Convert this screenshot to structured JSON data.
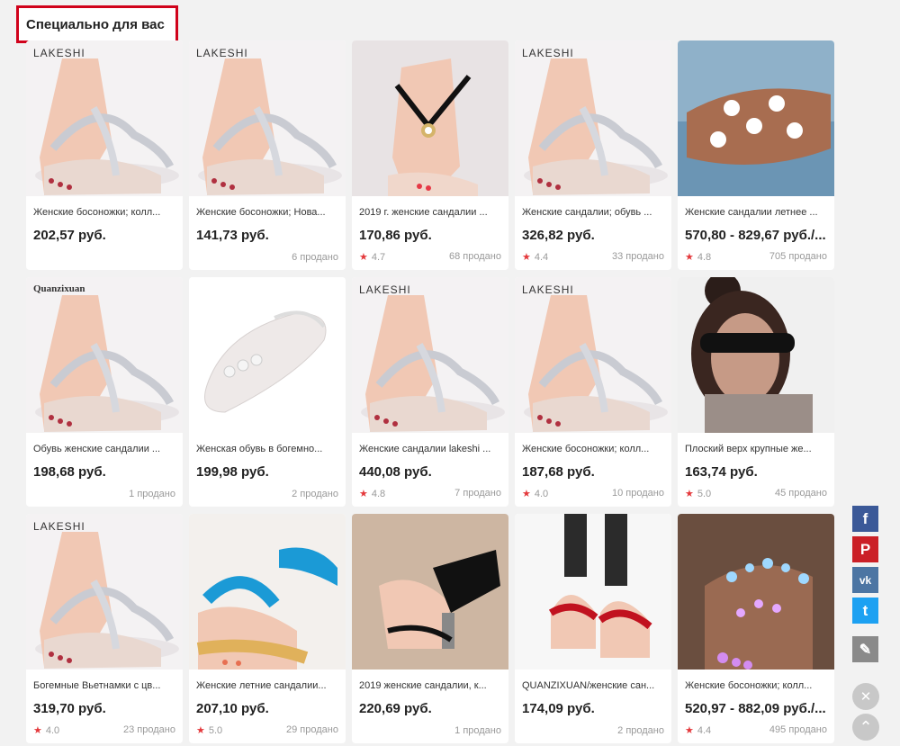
{
  "section": {
    "title": "Специально для вас"
  },
  "products": [
    {
      "brand": "LAKESHI",
      "title": "Женские босоножки; колл...",
      "price": "202,57 руб.",
      "rating": "",
      "sold": "",
      "img": "crystal"
    },
    {
      "brand": "LAKESHI",
      "title": "Женские босоножки; Нова...",
      "price": "141,73 руб.",
      "rating": "",
      "sold": "6 продано",
      "img": "crystal"
    },
    {
      "brand": "",
      "title": "2019 г. женские сандалии ...",
      "price": "170,86 руб.",
      "rating": "4.7",
      "sold": "68 продано",
      "img": "owl"
    },
    {
      "brand": "LAKESHI",
      "title": "Женские сандалии; обувь ...",
      "price": "326,82 руб.",
      "rating": "4.4",
      "sold": "33 продано",
      "img": "crystal"
    },
    {
      "brand": "",
      "title": "Женские сандалии летнее ...",
      "price": "570,80 - 829,67 руб./...",
      "rating": "4.8",
      "sold": "705 продано",
      "img": "flowers"
    },
    {
      "brand": "Quanzixuan",
      "title": "Обувь женские сандалии ...",
      "price": "198,68 руб.",
      "rating": "",
      "sold": "1 продано",
      "img": "crystal"
    },
    {
      "brand": "",
      "title": "Женская обувь в богемно...",
      "price": "199,98 руб.",
      "rating": "",
      "sold": "2 продано",
      "img": "white"
    },
    {
      "brand": "LAKESHI",
      "title": "Женские сандалии lakeshi ...",
      "price": "440,08 руб.",
      "rating": "4.8",
      "sold": "7 продано",
      "img": "crystal"
    },
    {
      "brand": "LAKESHI",
      "title": "Женские босоножки; колл...",
      "price": "187,68 руб.",
      "rating": "4.0",
      "sold": "10 продано",
      "img": "crystal"
    },
    {
      "brand": "",
      "title": "Плоский верх крупные же...",
      "price": "163,74 руб.",
      "rating": "5.0",
      "sold": "45 продано",
      "img": "sunglasses"
    },
    {
      "brand": "LAKESHI",
      "title": "Богемные Вьетнамки с цв...",
      "price": "319,70 руб.",
      "rating": "4.0",
      "sold": "23 продано",
      "img": "crystal"
    },
    {
      "brand": "",
      "title": "Женские летние сандалии...",
      "price": "207,10 руб.",
      "rating": "5.0",
      "sold": "29 продано",
      "img": "blue"
    },
    {
      "brand": "",
      "title": "2019 женские сандалии, к...",
      "price": "220,69 руб.",
      "rating": "",
      "sold": "1 продано",
      "img": "black"
    },
    {
      "brand": "",
      "title": "QUANZIXUAN/женские сан...",
      "price": "174,09 руб.",
      "rating": "",
      "sold": "2 продано",
      "img": "red"
    },
    {
      "brand": "",
      "title": "Женские босоножки; колл...",
      "price": "520,97 - 882,09 руб./...",
      "rating": "4.4",
      "sold": "495 продано",
      "img": "gems"
    }
  ],
  "share": [
    {
      "name": "facebook-icon",
      "glyph": "f",
      "color": "#3b5998"
    },
    {
      "name": "pinterest-icon",
      "glyph": "P",
      "color": "#cb2027"
    },
    {
      "name": "vk-icon",
      "glyph": "vk",
      "color": "#4c75a3"
    },
    {
      "name": "twitter-icon",
      "glyph": "t",
      "color": "#1da1f2"
    }
  ],
  "actions": {
    "edit": "✎",
    "close": "✕",
    "up": "⌃"
  }
}
